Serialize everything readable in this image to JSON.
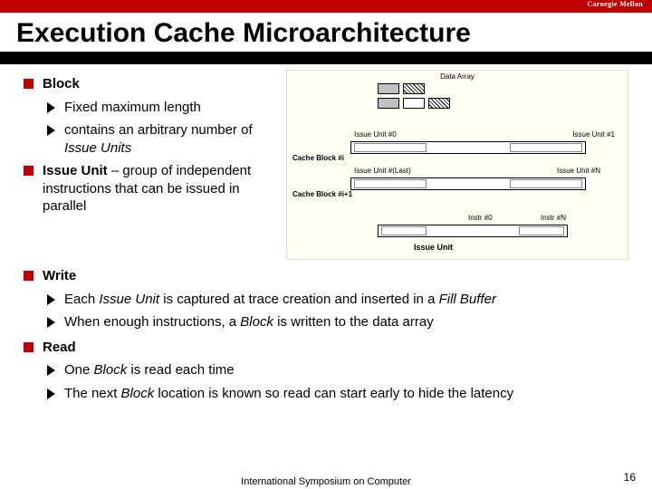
{
  "brand": "Carnegie Mellon",
  "title": "Execution Cache Microarchitecture",
  "bullets": {
    "block": {
      "label": "Block",
      "sub1": "Fixed maximum length",
      "sub2_a": "contains an arbitrary number of ",
      "sub2_b": "Issue Units"
    },
    "issue_unit": {
      "label": "Issue Unit",
      "rest": " – group of independent instructions that can be issued in parallel"
    },
    "write": {
      "label": "Write",
      "sub1_a": "Each ",
      "sub1_b": "Issue Unit",
      "sub1_c": " is captured at trace creation and inserted in a ",
      "sub1_d": "Fill Buffer",
      "sub2_a": "When enough instructions, a ",
      "sub2_b": "Block",
      "sub2_c": " is written to the data array"
    },
    "read": {
      "label": "Read",
      "sub1_a": "One ",
      "sub1_b": "Block",
      "sub1_c": " is read each time",
      "sub2_a": "The next ",
      "sub2_b": "Block",
      "sub2_c": " location is known so read can start early to hide the latency"
    }
  },
  "diagram": {
    "data_array": "Data Array",
    "issue_unit_0": "Issue Unit #0",
    "issue_unit_1": "Issue Unit #1",
    "cache_block_i": "Cache Block #i",
    "issue_unit_last": "Issue Unit #(Last)",
    "issue_unit_n": "Issue Unit #N",
    "cache_block_i1": "Cache Block #i+1",
    "instr_0": "Instr #0",
    "instr_n": "Instr #N",
    "issue_unit_lbl": "Issue Unit"
  },
  "footer": "International Symposium on Computer",
  "page": "16"
}
